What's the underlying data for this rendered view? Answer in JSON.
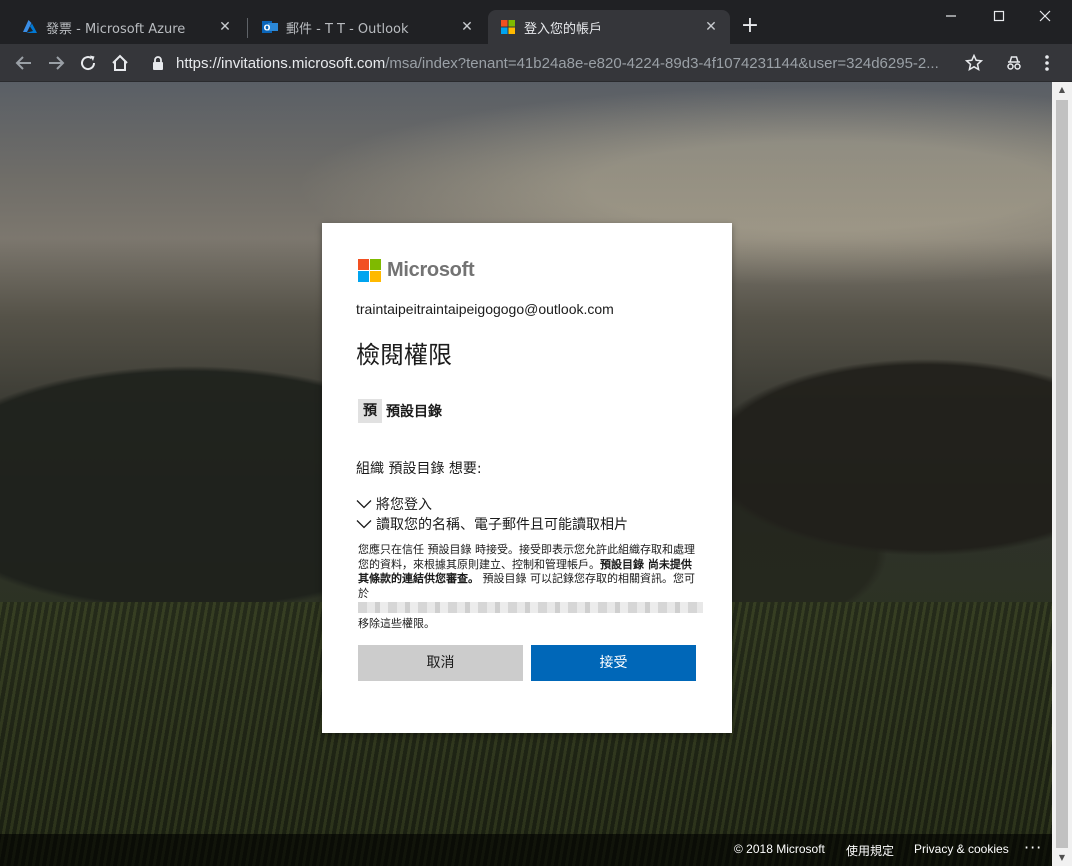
{
  "browser": {
    "tabs": [
      {
        "title": "發票 - Microsoft Azure",
        "icon": "azure-icon",
        "active": false
      },
      {
        "title": "郵件 - T T - Outlook",
        "icon": "outlook-icon",
        "active": false
      },
      {
        "title": "登入您的帳戶",
        "icon": "microsoft-icon",
        "active": true
      }
    ],
    "new_tab": "+",
    "url_host": "https://invitations.microsoft.com",
    "url_path": "/msa/index?tenant=41b24a8e-e820-4224-89d3-4f1074231144&user=324d6295-2..."
  },
  "dialog": {
    "brand": "Microsoft",
    "brand_colors": [
      "#f25022",
      "#7fba00",
      "#00a4ef",
      "#ffb900"
    ],
    "email": "traintaipeitraintaipeigogogo@outlook.com",
    "heading": "檢閱權限",
    "app_badge": "預",
    "app_name": "預設目錄",
    "org_wants": "組織 預設目錄 想要:",
    "permissions": [
      "將您登入",
      "讀取您的名稱、電子郵件且可能讀取相片"
    ],
    "notice": {
      "part1": "您應只在信任 預設目錄 時接受。接受即表示您允許此組織存取和處理您的資料，來根據其原則建立、控制和管理帳戶。",
      "bold": "預設目錄 尚未提供其條款的連結供您審查。",
      "part2": "預設目錄 可以記錄您存取的相關資訊。您可於"
    },
    "remove_text": "移除這些權限。",
    "cancel_label": "取消",
    "accept_label": "接受",
    "accent_color": "#0067b8"
  },
  "footer": {
    "copyright": "© 2018 Microsoft",
    "terms": "使用規定",
    "privacy": "Privacy & cookies",
    "more": "···"
  }
}
